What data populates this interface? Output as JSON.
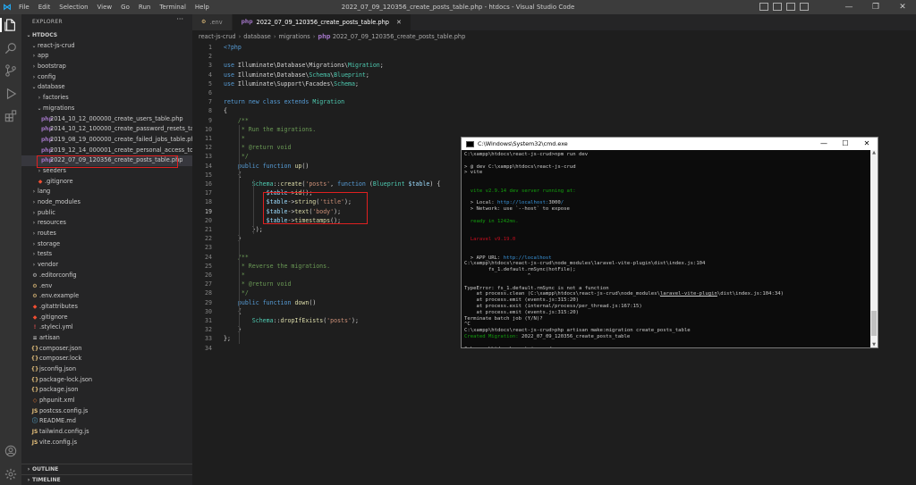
{
  "window": {
    "title": "2022_07_09_120356_create_posts_table.php - htdocs - Visual Studio Code",
    "menu": [
      "File",
      "Edit",
      "Selection",
      "View",
      "Go",
      "Run",
      "Terminal",
      "Help"
    ],
    "controls": [
      "—",
      "❐",
      "✕"
    ]
  },
  "activity_icons": [
    "explorer-icon",
    "search-icon",
    "source-control-icon",
    "run-debug-icon",
    "extensions-icon",
    "account-icon",
    "settings-gear-icon"
  ],
  "sidebar": {
    "title": "EXPLORER",
    "root": "HTDOCS",
    "project": "react-js-crud",
    "items": [
      {
        "label": "app",
        "type": "folder",
        "depth": 2
      },
      {
        "label": "bootstrap",
        "type": "folder",
        "depth": 2
      },
      {
        "label": "config",
        "type": "folder",
        "depth": 2
      },
      {
        "label": "database",
        "type": "folder-open",
        "depth": 2
      },
      {
        "label": "factories",
        "type": "folder",
        "depth": 3
      },
      {
        "label": "migrations",
        "type": "folder-open",
        "depth": 3
      },
      {
        "label": "2014_10_12_000000_create_users_table.php",
        "type": "php",
        "depth": 4
      },
      {
        "label": "2014_10_12_100000_create_password_resets_tabl...",
        "type": "php",
        "depth": 4
      },
      {
        "label": "2019_08_19_000000_create_failed_jobs_table.php",
        "type": "php",
        "depth": 4
      },
      {
        "label": "2019_12_14_000001_create_personal_access_toke...",
        "type": "php",
        "depth": 4
      },
      {
        "label": "2022_07_09_120356_create_posts_table.php",
        "type": "php",
        "depth": 4,
        "selected": true
      },
      {
        "label": "seeders",
        "type": "folder",
        "depth": 3
      },
      {
        "label": ".gitignore",
        "type": "git",
        "depth": 3
      },
      {
        "label": "lang",
        "type": "folder",
        "depth": 2
      },
      {
        "label": "node_modules",
        "type": "folder",
        "depth": 2
      },
      {
        "label": "public",
        "type": "folder",
        "depth": 2
      },
      {
        "label": "resources",
        "type": "folder",
        "depth": 2
      },
      {
        "label": "routes",
        "type": "folder",
        "depth": 2
      },
      {
        "label": "storage",
        "type": "folder",
        "depth": 2
      },
      {
        "label": "tests",
        "type": "folder",
        "depth": 2
      },
      {
        "label": "vendor",
        "type": "folder",
        "depth": 2
      },
      {
        "label": ".editorconfig",
        "type": "config",
        "depth": 2
      },
      {
        "label": ".env",
        "type": "env",
        "depth": 2
      },
      {
        "label": ".env.example",
        "type": "env",
        "depth": 2
      },
      {
        "label": ".gitattributes",
        "type": "git",
        "depth": 2
      },
      {
        "label": ".gitignore",
        "type": "git",
        "depth": 2
      },
      {
        "label": ".styleci.yml",
        "type": "yml",
        "depth": 2
      },
      {
        "label": "artisan",
        "type": "text",
        "depth": 2
      },
      {
        "label": "composer.json",
        "type": "json",
        "depth": 2
      },
      {
        "label": "composer.lock",
        "type": "lock",
        "depth": 2
      },
      {
        "label": "jsconfig.json",
        "type": "json",
        "depth": 2
      },
      {
        "label": "package-lock.json",
        "type": "json",
        "depth": 2
      },
      {
        "label": "package.json",
        "type": "json",
        "depth": 2
      },
      {
        "label": "phpunit.xml",
        "type": "xml",
        "depth": 2
      },
      {
        "label": "postcss.config.js",
        "type": "js",
        "depth": 2
      },
      {
        "label": "README.md",
        "type": "md",
        "depth": 2
      },
      {
        "label": "tailwind.config.js",
        "type": "js",
        "depth": 2
      },
      {
        "label": "vite.config.js",
        "type": "js",
        "depth": 2
      }
    ],
    "outline": "OUTLINE",
    "timeline": "TIMELINE"
  },
  "tabs": [
    {
      "label": ".env",
      "active": false
    },
    {
      "label": "2022_07_09_120356_create_posts_table.php",
      "active": true
    }
  ],
  "breadcrumb": [
    "react-js-crud",
    "database",
    "migrations",
    "2022_07_09_120356_create_posts_table.php"
  ],
  "code": [
    "<?php",
    "",
    "use Illuminate\\Database\\Migrations\\Migration;",
    "use Illuminate\\Database\\Schema\\Blueprint;",
    "use Illuminate\\Support\\Facades\\Schema;",
    "",
    "return new class extends Migration",
    "{",
    "    /**",
    "     * Run the migrations.",
    "     *",
    "     * @return void",
    "     */",
    "    public function up()",
    "    {",
    "        Schema::create('posts', function (Blueprint $table) {",
    "            $table->id();",
    "            $table->string('title');",
    "            $table->text('body');",
    "            $table->timestamps();",
    "        });",
    "    }",
    "",
    "    /**",
    "     * Reverse the migrations.",
    "     *",
    "     * @return void",
    "     */",
    "    public function down()",
    "    {",
    "        Schema::dropIfExists('posts');",
    "    }",
    "};",
    ""
  ],
  "current_line": 19,
  "cmd": {
    "title": "C:\\Windows\\System32\\cmd.exe",
    "controls": [
      "—",
      "☐",
      "✕"
    ],
    "lines": [
      [
        [
          "w",
          "C:\\xampp\\htdocs\\react-js-crud>npm run dev"
        ]
      ],
      [],
      [
        [
          "w",
          "> @ dev C:\\xampp\\htdocs\\react-js-crud"
        ]
      ],
      [
        [
          "w",
          "> vite"
        ]
      ],
      [],
      [],
      [
        [
          "g",
          "  vite v2.9.14 dev server running at:"
        ]
      ],
      [],
      [
        [
          "w",
          "  > Local: "
        ],
        [
          "c",
          "http://localhost:"
        ],
        [
          "w",
          "3000"
        ],
        [
          "c",
          "/"
        ]
      ],
      [
        [
          "w",
          "  > Network: use `--host` to expose"
        ]
      ],
      [],
      [
        [
          "g",
          "  ready in 1242ms."
        ]
      ],
      [],
      [],
      [
        [
          "r",
          "  Laravel v9.19.0"
        ]
      ],
      [],
      [],
      [
        [
          "w",
          "  > APP_URL: "
        ],
        [
          "c",
          "http://localhost"
        ]
      ],
      [
        [
          "w",
          "C:\\xampp\\htdocs\\react-js-crud\\node_modules\\laravel-vite-plugin\\dist\\index.js:104"
        ]
      ],
      [
        [
          "w",
          "        fs_1.default.rmSync(hotFile);"
        ]
      ],
      [
        [
          "w",
          "                     ^"
        ]
      ],
      [],
      [
        [
          "w",
          "TypeError: fs_1.default.rmSync is not a function"
        ]
      ],
      [
        [
          "w",
          "    at process.clean (C:\\xampp\\htdocs\\react-js-crud\\node_modules\\"
        ],
        [
          "wu",
          "laravel-vite-plugin"
        ],
        [
          "w",
          "\\dist\\index.js:104:34)"
        ]
      ],
      [
        [
          "w",
          "    at process.emit (events.js:315:20)"
        ]
      ],
      [
        [
          "w",
          "    at process.exit (internal/process/per_thread.js:167:15)"
        ]
      ],
      [
        [
          "w",
          "    at process.emit (events.js:315:20)"
        ]
      ],
      [
        [
          "w",
          "Terminate batch job (Y/N)?"
        ]
      ],
      [
        [
          "w",
          "^C"
        ]
      ],
      [
        [
          "w",
          "C:\\xampp\\htdocs\\react-js-crud>php artisan make:migration create_posts_table"
        ]
      ],
      [
        [
          "g",
          "Created Migration: "
        ],
        [
          "w",
          "2022_07_09_120356_create_posts_table"
        ]
      ],
      [],
      [
        [
          "w",
          "C:\\xampp\\htdocs\\react-js-crud>"
        ],
        [
          "cursor",
          ""
        ]
      ]
    ]
  },
  "colors": {
    "highlight_box": "#e02020",
    "accent": "#007acc"
  }
}
